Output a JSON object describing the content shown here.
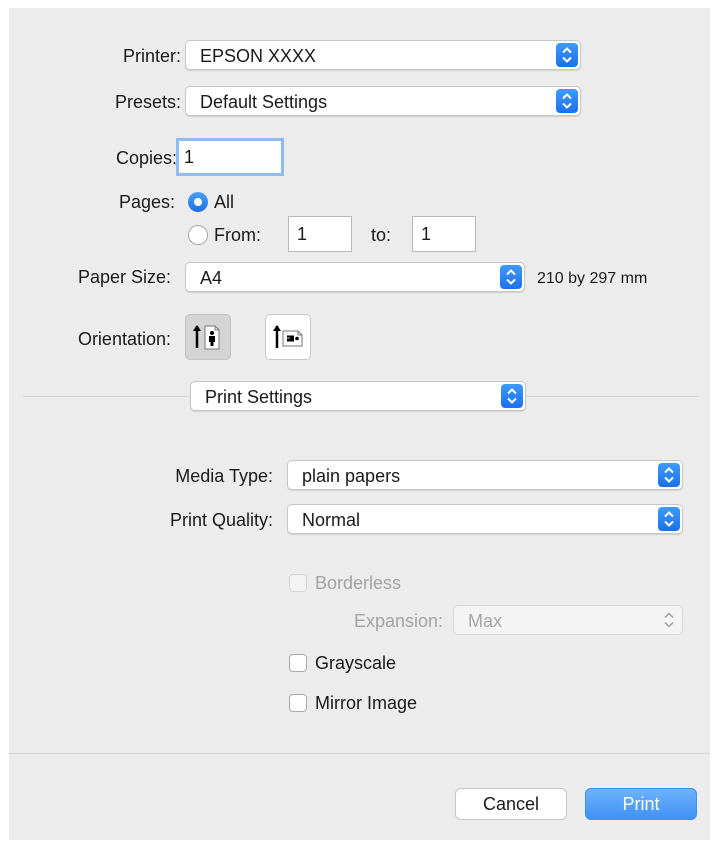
{
  "printer": {
    "label": "Printer:",
    "value": "EPSON XXXX"
  },
  "presets": {
    "label": "Presets:",
    "value": "Default Settings"
  },
  "copies": {
    "label": "Copies:",
    "value": "1"
  },
  "pages": {
    "label": "Pages:",
    "all_label": "All",
    "from_label": "From:",
    "from_value": "1",
    "to_label": "to:",
    "to_value": "1",
    "selected": "All"
  },
  "paper_size": {
    "label": "Paper Size:",
    "value": "A4",
    "dimensions": "210 by 297 mm"
  },
  "orientation": {
    "label": "Orientation:",
    "selected": "portrait"
  },
  "section": {
    "value": "Print Settings"
  },
  "media_type": {
    "label": "Media Type:",
    "value": "plain papers"
  },
  "print_quality": {
    "label": "Print Quality:",
    "value": "Normal"
  },
  "borderless": {
    "label": "Borderless",
    "checked": false,
    "enabled": false
  },
  "expansion": {
    "label": "Expansion:",
    "value": "Max",
    "enabled": false
  },
  "grayscale": {
    "label": "Grayscale",
    "checked": false
  },
  "mirror_image": {
    "label": "Mirror Image",
    "checked": false
  },
  "buttons": {
    "cancel": "Cancel",
    "print": "Print"
  },
  "colors": {
    "accent": "#1b70ec",
    "dialog_bg": "#ececec",
    "disabled_text": "#a3a3a3"
  }
}
